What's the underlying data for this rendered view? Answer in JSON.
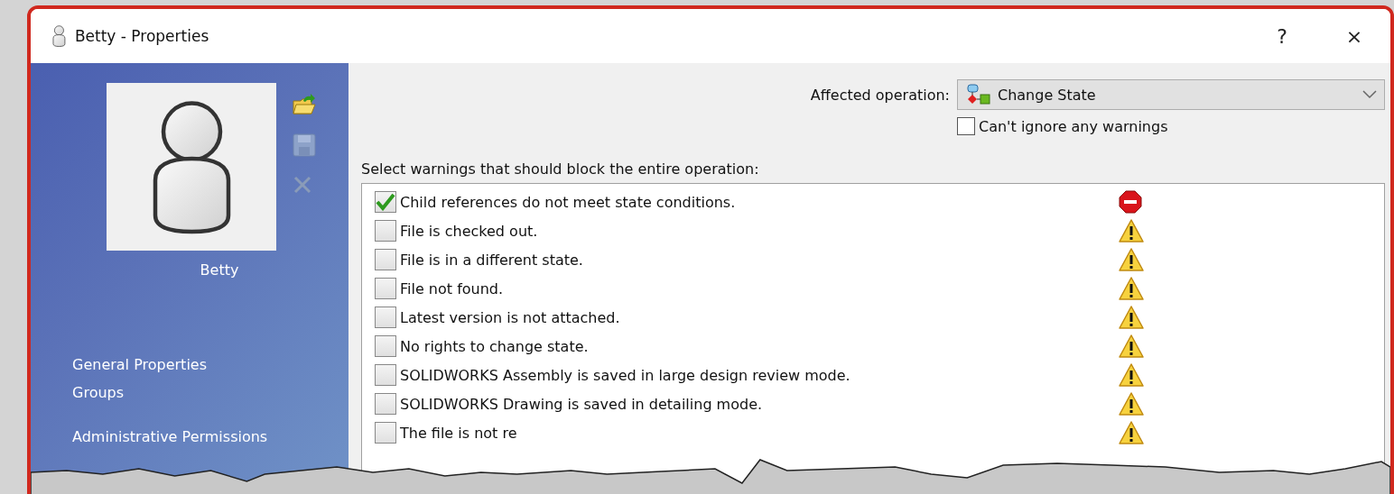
{
  "window": {
    "title": "Betty - Properties",
    "help": "?",
    "close": "×"
  },
  "sidebar": {
    "name": "Betty",
    "items": [
      "General Properties",
      "Groups",
      "Administrative Permissions"
    ]
  },
  "operation": {
    "label": "Affected operation:",
    "value": "Change State"
  },
  "cant_ignore": {
    "label": "Can't ignore any warnings",
    "checked": false
  },
  "list_label": "Select warnings that should block the entire operation:",
  "warnings": [
    {
      "label": "Child references do not meet state conditions.",
      "checked": true,
      "kind": "error"
    },
    {
      "label": "File is checked out.",
      "checked": false,
      "kind": "warning"
    },
    {
      "label": "File is in a different state.",
      "checked": false,
      "kind": "warning"
    },
    {
      "label": "File not found.",
      "checked": false,
      "kind": "warning"
    },
    {
      "label": "Latest version is not attached.",
      "checked": false,
      "kind": "warning"
    },
    {
      "label": "No rights to change state.",
      "checked": false,
      "kind": "warning"
    },
    {
      "label": "SOLIDWORKS Assembly is saved in large design review mode.",
      "checked": false,
      "kind": "warning"
    },
    {
      "label": "SOLIDWORKS Drawing is saved in detailing mode.",
      "checked": false,
      "kind": "warning"
    },
    {
      "label": "The file is not re",
      "checked": false,
      "kind": "warning"
    }
  ]
}
